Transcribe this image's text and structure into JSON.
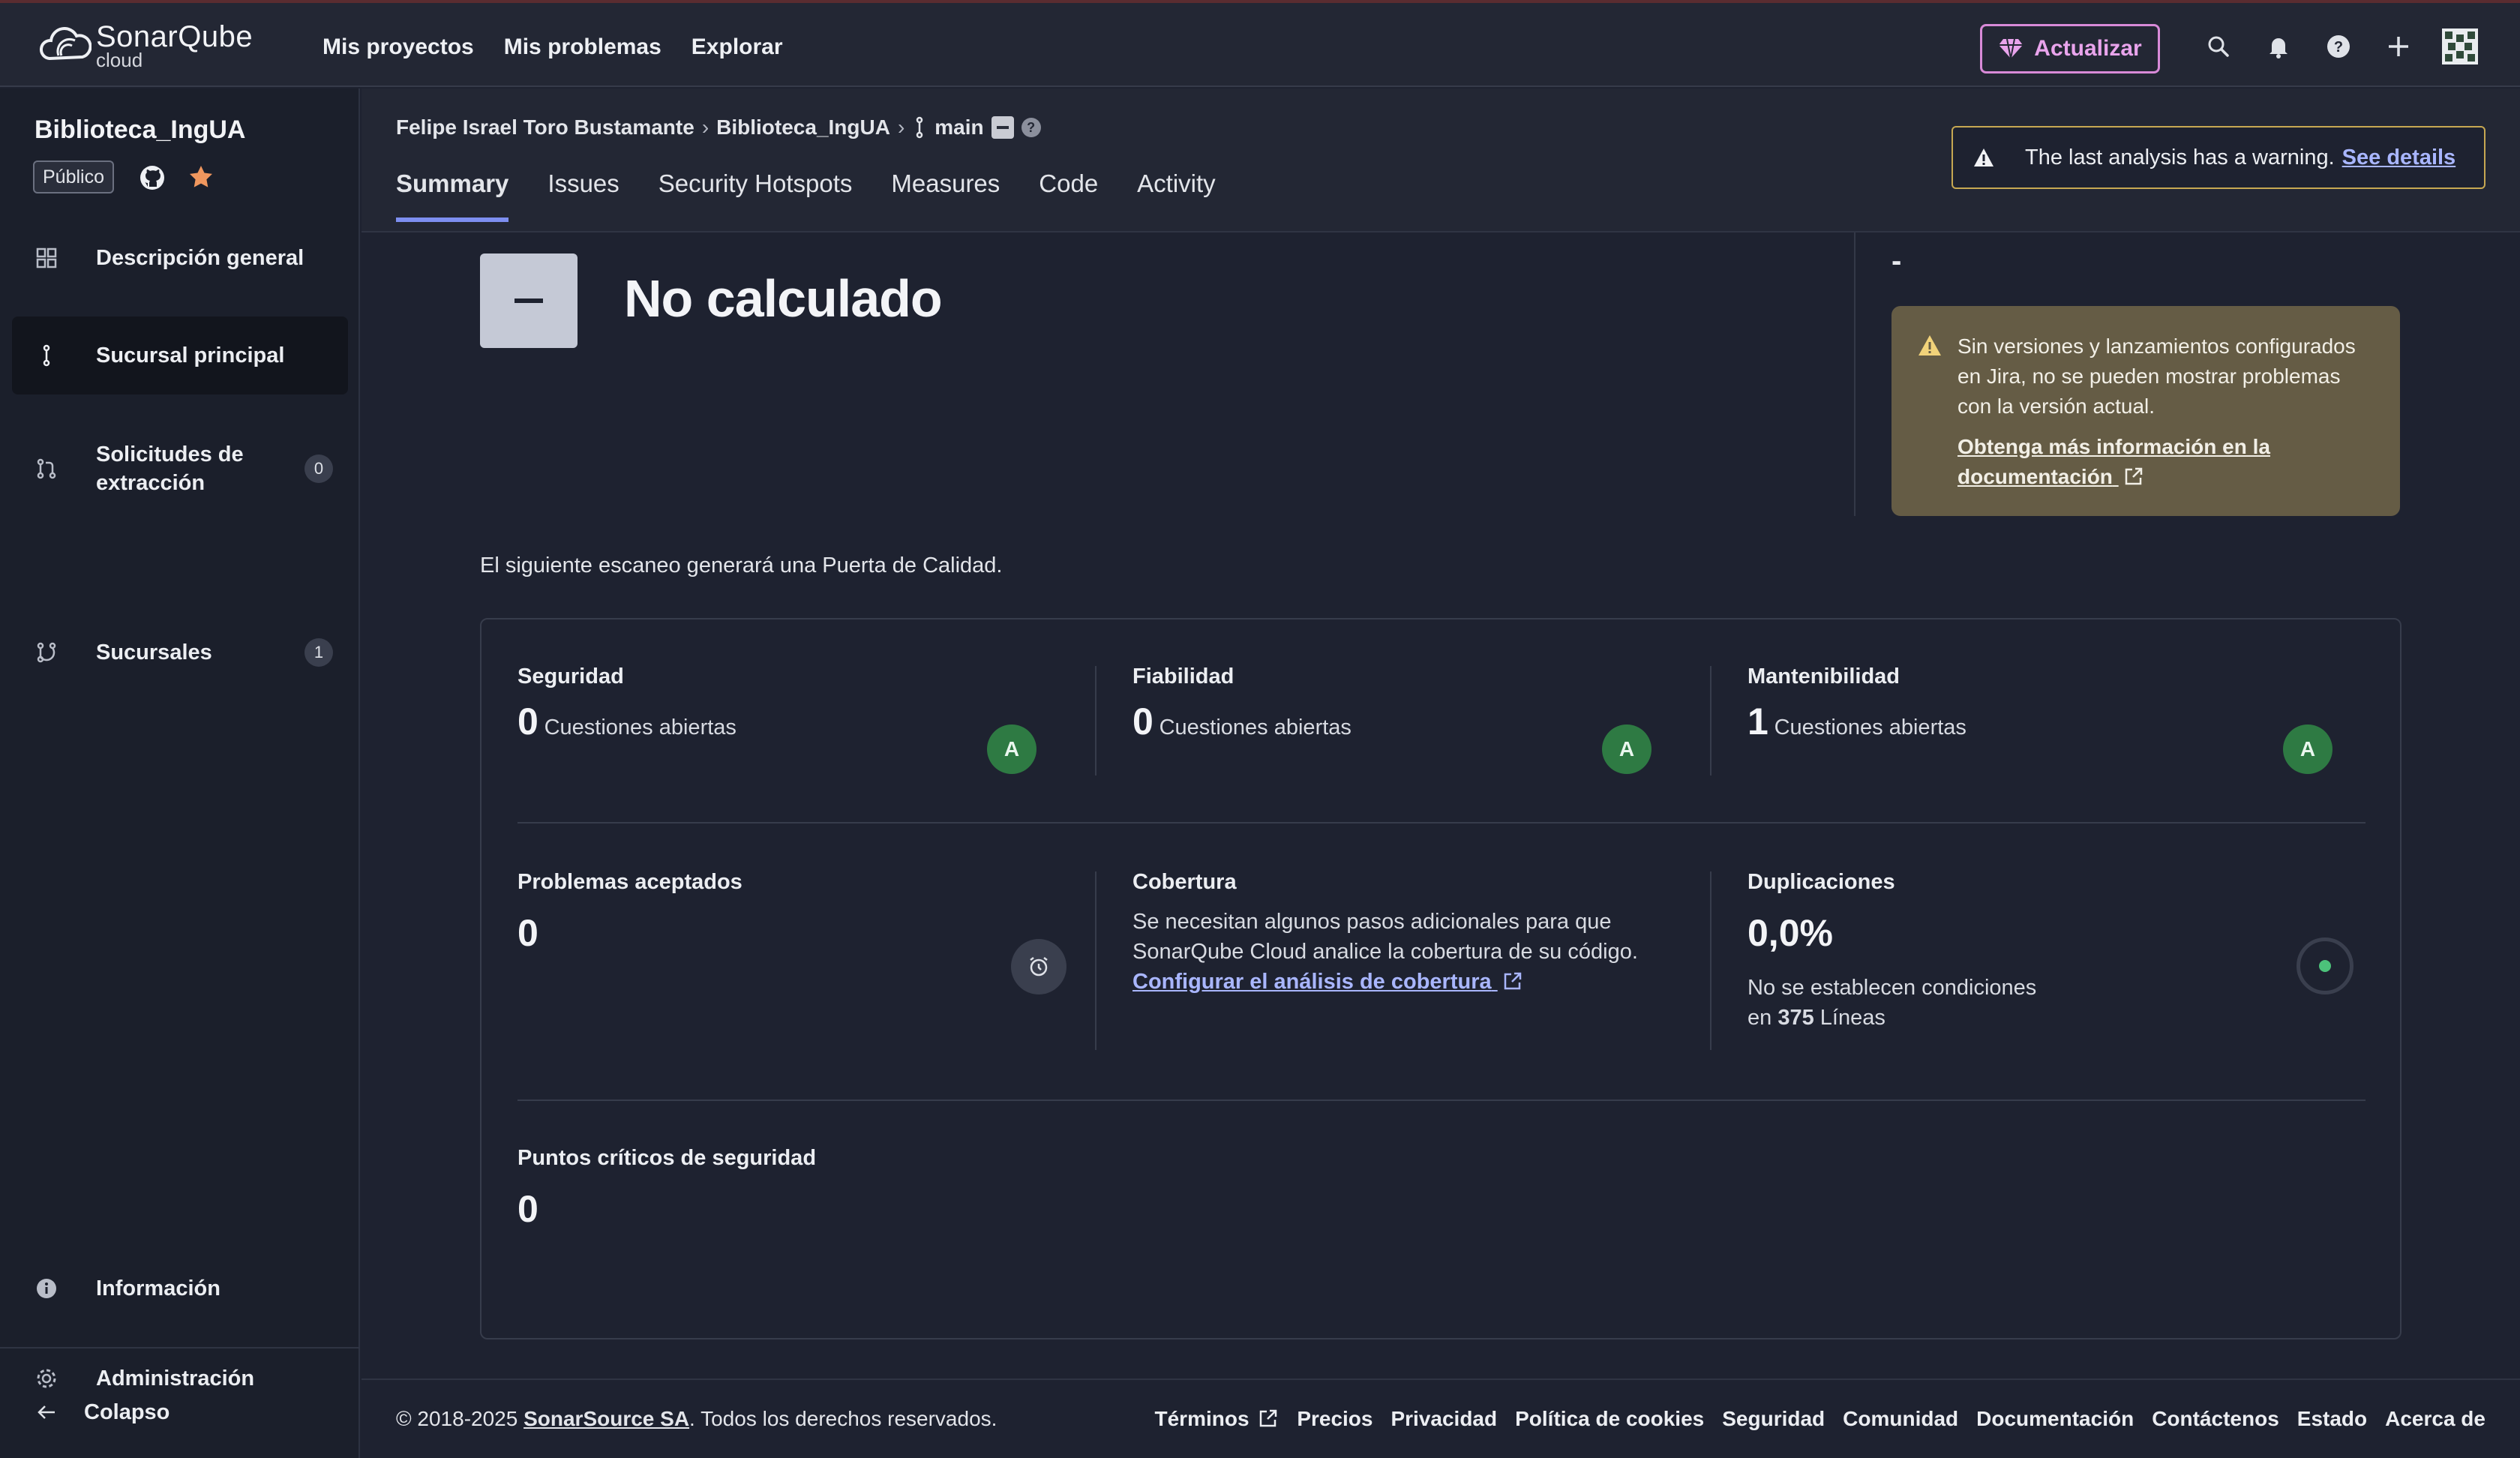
{
  "topbar": {
    "logo_name": "SonarQube",
    "logo_sub": "cloud",
    "nav": [
      "Mis proyectos",
      "Mis problemas",
      "Explorar"
    ],
    "upgrade_label": "Actualizar",
    "icons": [
      "search-icon",
      "bell-icon",
      "help-icon",
      "plus-icon",
      "avatar"
    ]
  },
  "sidebar": {
    "project_name": "Biblioteca_IngUA",
    "visibility": "Público",
    "items": [
      {
        "label": "Descripción general",
        "icon": "grid-icon"
      },
      {
        "label": "Sucursal principal",
        "icon": "branch-icon"
      },
      {
        "label": "Solicitudes de extracción",
        "icon": "pull-request-icon",
        "count": "0"
      },
      {
        "label": "Sucursales",
        "icon": "branches-icon",
        "count": "1"
      }
    ],
    "info_label": "Información",
    "admin_label": "Administración",
    "collapse_label": "Colapso"
  },
  "subheader": {
    "breadcrumb": [
      "Felipe Israel Toro Bustamante",
      "Biblioteca_IngUA",
      "main"
    ],
    "tabs": [
      "Summary",
      "Issues",
      "Security Hotspots",
      "Measures",
      "Code",
      "Activity"
    ],
    "warning_text": "The last analysis has a warning.",
    "warning_link": "See details"
  },
  "quality_gate": {
    "status": "No calculado",
    "next_scan": "El siguiente escaneo generará una Puerta de Calidad."
  },
  "jira": {
    "value": "-",
    "message": "Sin versiones y lanzamientos configurados en Jira, no se pueden mostrar problemas con la versión actual.",
    "link": "Obtenga más información en la documentación"
  },
  "metrics": {
    "security": {
      "title": "Seguridad",
      "value": "0",
      "sub": "Cuestiones abiertas",
      "grade": "A"
    },
    "reliability": {
      "title": "Fiabilidad",
      "value": "0",
      "sub": "Cuestiones abiertas",
      "grade": "A"
    },
    "maintainability": {
      "title": "Mantenibilidad",
      "value": "1",
      "sub": "Cuestiones abiertas",
      "grade": "A"
    },
    "accepted": {
      "title": "Problemas aceptados",
      "value": "0"
    },
    "coverage": {
      "title": "Cobertura",
      "text": "Se necesitan algunos pasos adicionales para que SonarQube Cloud analice la cobertura de su código.",
      "link": "Configurar el análisis de cobertura"
    },
    "duplications": {
      "title": "Duplicaciones",
      "value": "0,0%",
      "text1": "No se establecen condiciones",
      "text2_prefix": "en",
      "lines": "375",
      "text2_suffix": "Líneas"
    },
    "hotspots": {
      "title": "Puntos críticos de seguridad",
      "value": "0"
    }
  },
  "footer": {
    "copy_prefix": "© 2018-2025",
    "company": "SonarSource SA",
    "copy_suffix": ". Todos los derechos reservados.",
    "links": [
      "Términos",
      "Precios",
      "Privacidad",
      "Política de cookies",
      "Seguridad",
      "Comunidad",
      "Documentación",
      "Contáctenos",
      "Estado",
      "Acerca de"
    ]
  },
  "colors": {
    "background": "#1e2230",
    "accent": "#7d8ef0",
    "grade_a": "#2e7a43",
    "warning": "#c7a852",
    "upgrade": "#d88ad8"
  }
}
